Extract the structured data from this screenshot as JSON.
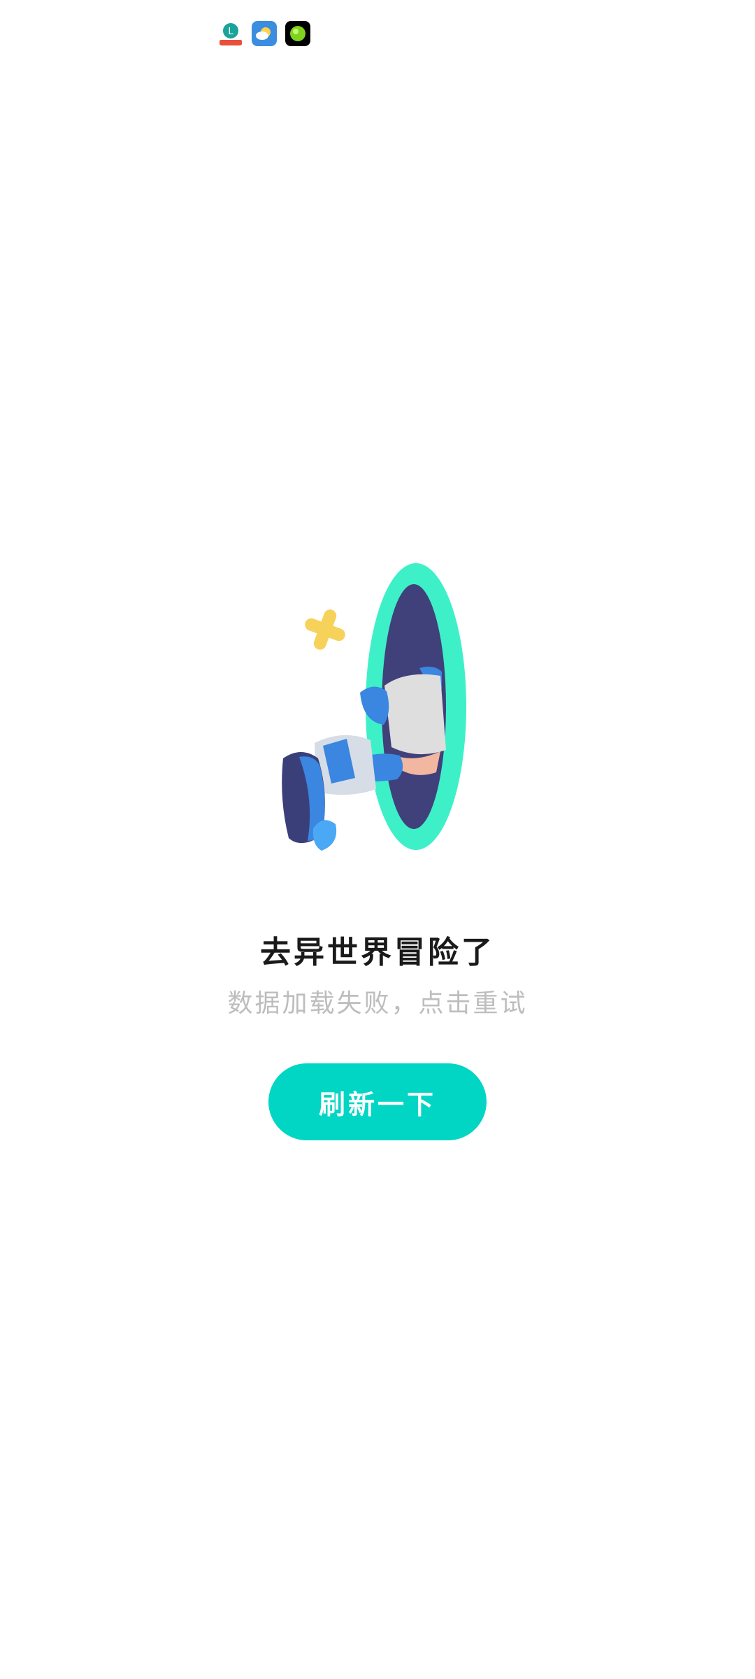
{
  "status_bar": {
    "icons": [
      {
        "name": "lottery-app-icon",
        "color": "#1aa39a"
      },
      {
        "name": "weather-app-icon",
        "color": "#3b8de0"
      },
      {
        "name": "green-dot-app-icon",
        "color": "#7ed321"
      }
    ]
  },
  "illustration": {
    "name": "portal-adventure-illustration",
    "colors": {
      "portal_ring": "#3ef0c8",
      "portal_inner": "#40407a",
      "shoe_blue": "#3a86e0",
      "star_yellow": "#f7d25a"
    }
  },
  "error_state": {
    "title": "去异世界冒险了",
    "subtitle": "数据加载失败，点击重试",
    "refresh_label": "刷新一下"
  },
  "colors": {
    "accent": "#00d6c3",
    "title_text": "#1a1a1a",
    "subtitle_text": "#bdbdbd"
  }
}
